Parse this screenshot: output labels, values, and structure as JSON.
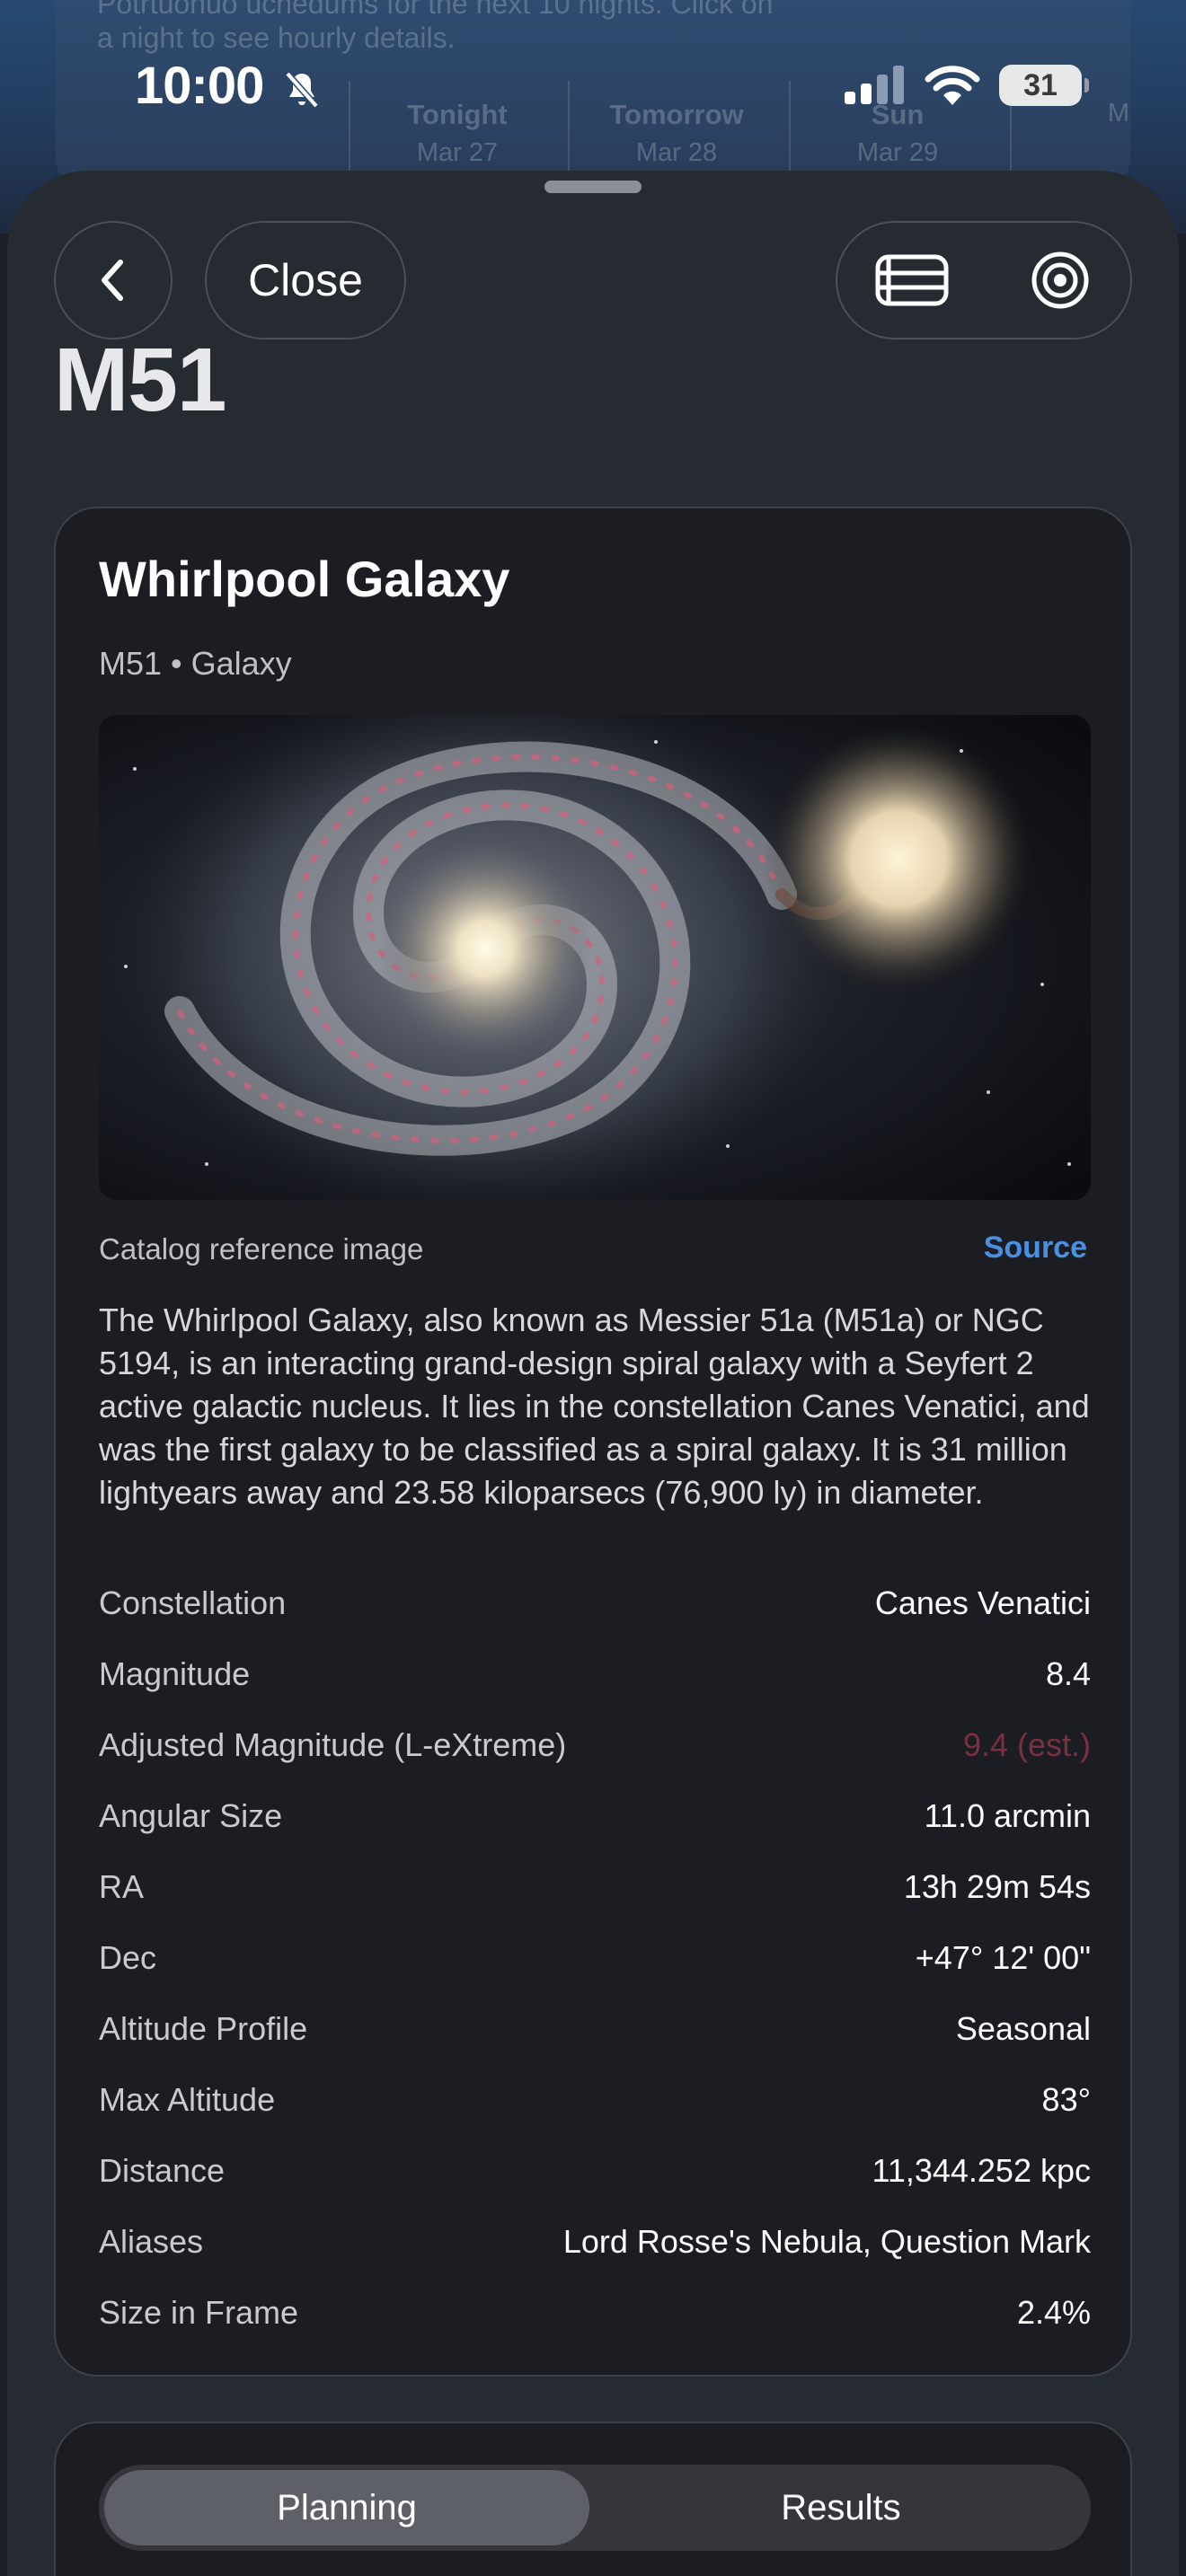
{
  "background": {
    "hint_line_1": "Potrtuonuo ucnedums for the next 10 nights. Click on",
    "hint_line_2": "a night to see hourly details.",
    "days": [
      {
        "day": "Tonight",
        "date": "Mar 27"
      },
      {
        "day": "Tomorrow",
        "date": "Mar 28"
      },
      {
        "day": "Sun",
        "date": "Mar 29"
      },
      {
        "day": "",
        "date": "M"
      }
    ]
  },
  "status_bar": {
    "time": "10:00",
    "battery": "31"
  },
  "header": {
    "close_label": "Close",
    "title": "M51"
  },
  "object": {
    "name": "Whirlpool Galaxy",
    "subtitle": "M51 • Galaxy",
    "image_caption": "Catalog reference image",
    "source_label": "Source",
    "description": "The Whirlpool Galaxy, also known as Messier 51a (M51a) or NGC 5194, is an interacting grand-design spiral galaxy with a Seyfert 2 active galactic nucleus. It lies in the constellation Canes Venatici, and was the first galaxy to be classified as a spiral galaxy. It is 31 million lightyears away and 23.58 kiloparsecs (76,900 ly) in diameter.",
    "properties": [
      {
        "label": "Constellation",
        "value": "Canes Venatici"
      },
      {
        "label": "Magnitude",
        "value": "8.4"
      },
      {
        "label": "Adjusted Magnitude (L-eXtreme)",
        "value": "9.4 (est.)",
        "color": "#7a3040"
      },
      {
        "label": "Angular Size",
        "value": "11.0 arcmin"
      },
      {
        "label": "RA",
        "value": "13h 29m 54s"
      },
      {
        "label": "Dec",
        "value": "+47° 12' 00\""
      },
      {
        "label": "Altitude Profile",
        "value": "Seasonal"
      },
      {
        "label": "Max Altitude",
        "value": "83°"
      },
      {
        "label": "Distance",
        "value": "11,344.252 kpc"
      },
      {
        "label": "Aliases",
        "value": "Lord Rosse's Nebula, Question Mark"
      },
      {
        "label": "Size in Frame",
        "value": "2.4%"
      }
    ]
  },
  "tabs": {
    "planning": "Planning",
    "results": "Results",
    "active": "Planning"
  },
  "icons": {
    "back": "chevron-left-icon",
    "list": "list-icon",
    "target": "target-icon"
  },
  "colors": {
    "accent_link": "#4a90e2",
    "card_bg": "#1c1d22",
    "sheet_bg": "#262a31"
  }
}
